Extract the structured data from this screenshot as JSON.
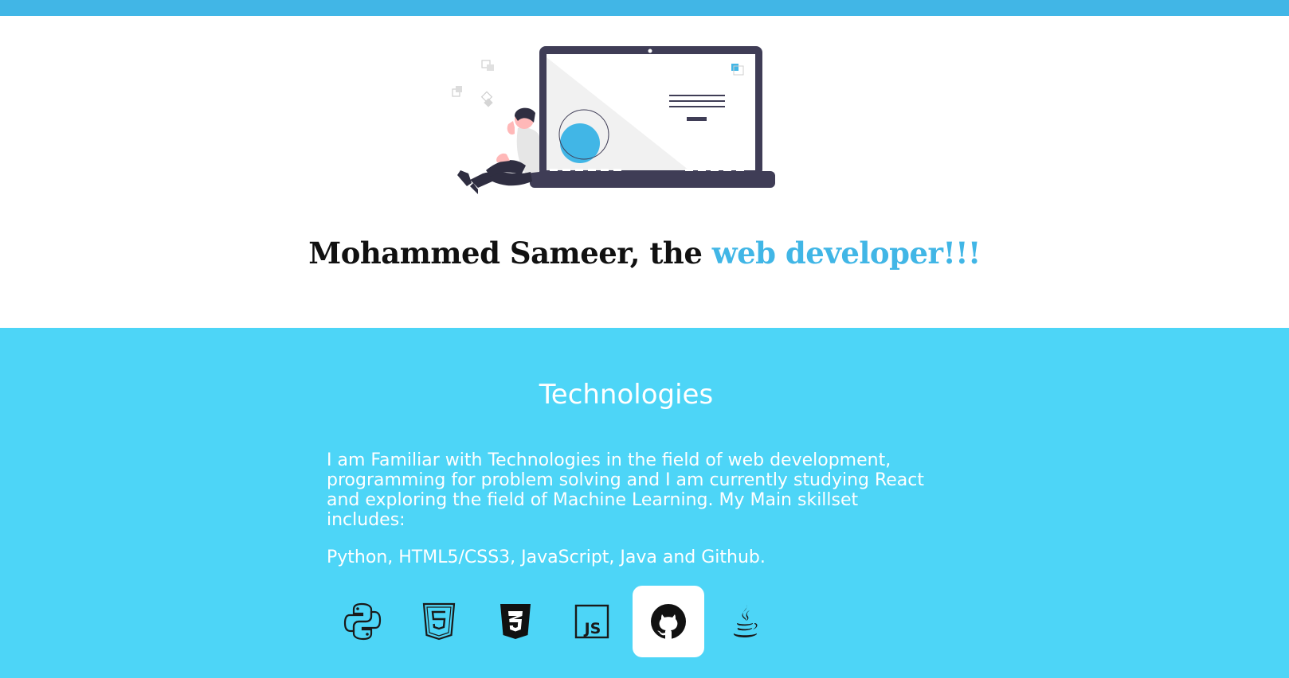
{
  "colors": {
    "accent": "#41b6e6",
    "tech_background": "#4dd5f7",
    "laptop_dark": "#3f3d56",
    "illustration_circle": "#41b6e6"
  },
  "hero": {
    "illustration": "person-leaning-on-laptop-illustration",
    "title_prefix": "Mohammed Sameer, the ",
    "title_accent": "web developer!!!"
  },
  "technologies": {
    "heading": "Technologies",
    "description": "I am Familiar with Technologies in the field of web development, programming for problem solving and I am currently studying React and exploring the field of Machine Learning. My Main skillset includes:",
    "skills": "Python, HTML5/CSS3, JavaScript, Java and Github.",
    "icons": [
      {
        "name": "python-icon",
        "active": false
      },
      {
        "name": "html5-icon",
        "active": false
      },
      {
        "name": "css3-icon",
        "active": false
      },
      {
        "name": "javascript-icon",
        "active": false
      },
      {
        "name": "github-icon",
        "active": true
      },
      {
        "name": "java-icon",
        "active": false
      }
    ]
  }
}
